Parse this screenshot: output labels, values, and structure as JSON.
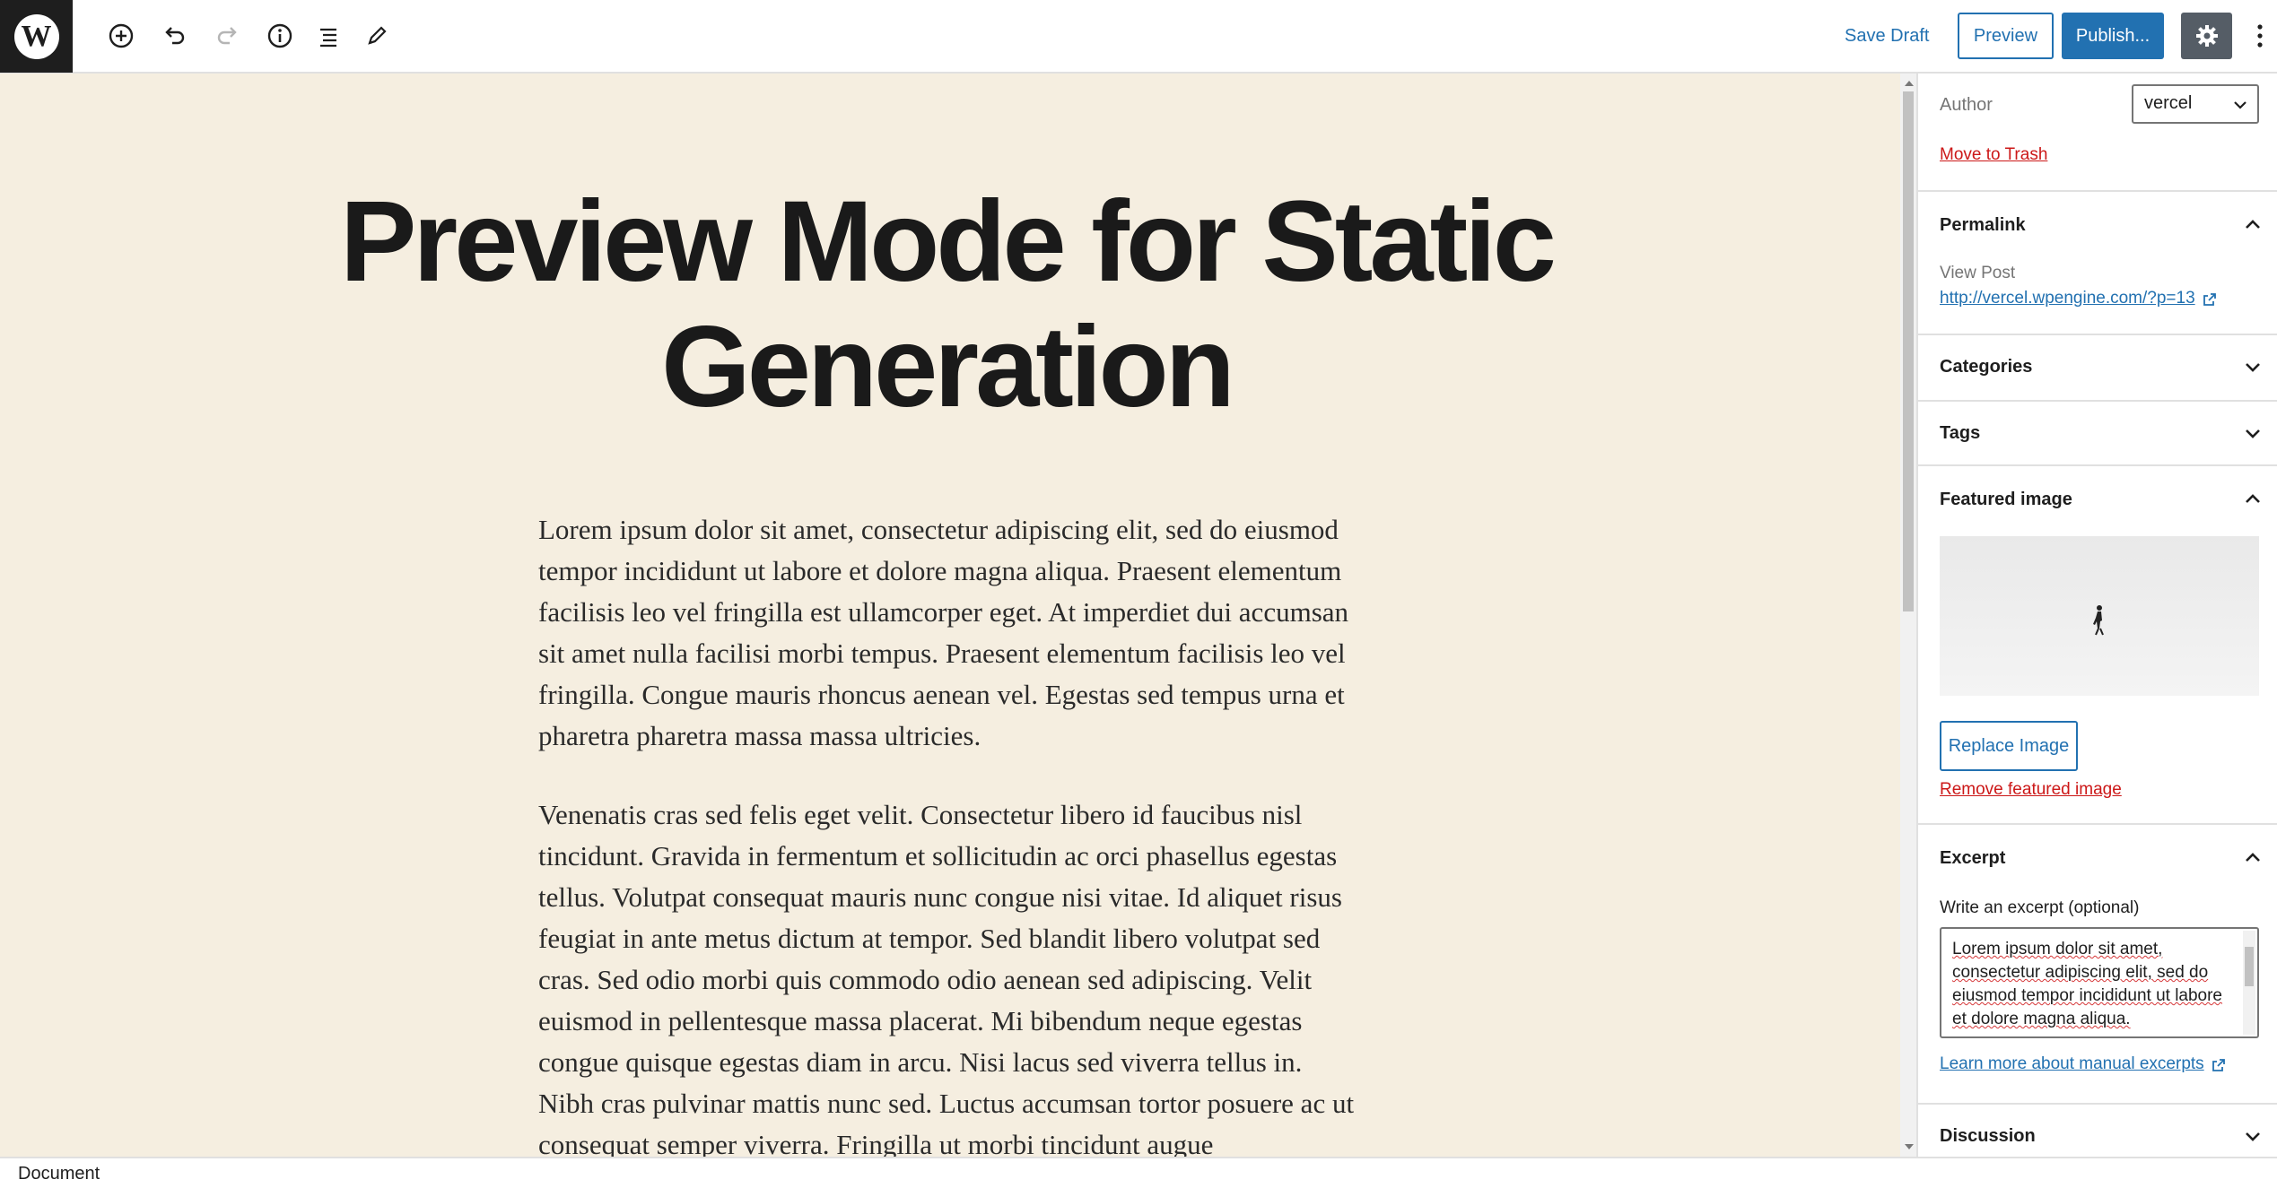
{
  "toolbar": {
    "logo": "W",
    "icons": [
      "add-block-icon",
      "undo-icon",
      "redo-icon",
      "info-icon",
      "list-view-icon",
      "edit-tool-icon"
    ],
    "save_draft": "Save Draft",
    "preview": "Preview",
    "publish": "Publish...",
    "settings_icon": "gear-icon",
    "more_icon": "more-vertical-icon",
    "accent_color": "#2271b1"
  },
  "editor": {
    "background_color": "#f5eee0",
    "title": "Preview Mode for Static Generation",
    "paragraphs": [
      "Lorem ipsum dolor sit amet, consectetur adipiscing elit, sed do eiusmod tempor incididunt ut labore et dolore magna aliqua. Praesent elementum facilisis leo vel fringilla est ullamcorper eget. At imperdiet dui accumsan sit amet nulla facilisi morbi tempus. Praesent elementum facilisis leo vel fringilla. Congue mauris rhoncus aenean vel. Egestas sed tempus urna et pharetra pharetra massa massa ultricies.",
      "Venenatis cras sed felis eget velit. Consectetur libero id faucibus nisl tincidunt. Gravida in fermentum et sollicitudin ac orci phasellus egestas tellus. Volutpat consequat mauris nunc congue nisi vitae. Id aliquet risus feugiat in ante metus dictum at tempor. Sed blandit libero volutpat sed cras. Sed odio morbi quis commodo odio aenean sed adipiscing. Velit euismod in pellentesque massa placerat. Mi bibendum neque egestas congue quisque egestas diam in arcu. Nisi lacus sed viverra tellus in. Nibh cras pulvinar mattis nunc sed. Luctus accumsan tortor posuere ac ut consequat semper viverra. Fringilla ut morbi tincidunt augue"
    ]
  },
  "sidebar": {
    "author_label": "Author",
    "author_value": "vercel",
    "move_to_trash": "Move to Trash",
    "permalink": {
      "heading": "Permalink",
      "view_post_label": "View Post",
      "url": "http://vercel.wpengine.com/?p=13"
    },
    "categories_heading": "Categories",
    "tags_heading": "Tags",
    "featured_image": {
      "heading": "Featured image",
      "replace": "Replace Image",
      "remove": "Remove featured image"
    },
    "excerpt": {
      "heading": "Excerpt",
      "label": "Write an excerpt (optional)",
      "value": "Lorem ipsum dolor sit amet, consectetur adipiscing elit, sed do eiusmod tempor incididunt ut labore et dolore magna aliqua.",
      "learn_more": "Learn more about manual excerpts"
    },
    "discussion_heading": "Discussion"
  },
  "footer": {
    "breadcrumb": "Document"
  }
}
